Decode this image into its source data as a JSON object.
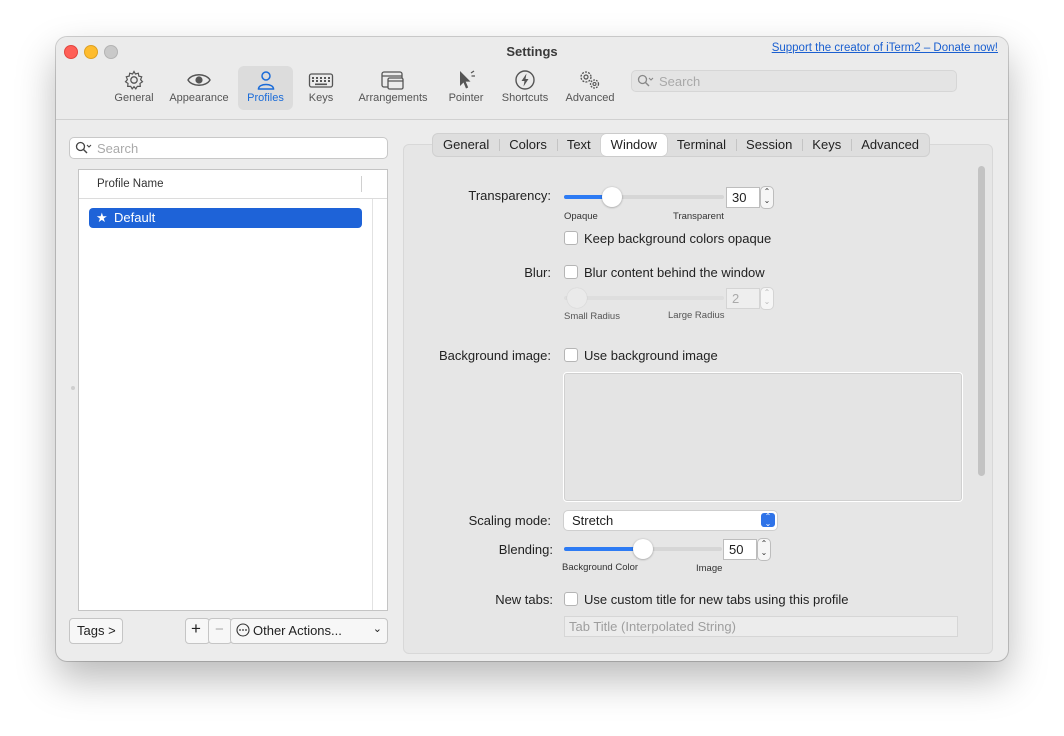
{
  "window": {
    "title": "Settings",
    "donate_link": "Support the creator of iTerm2 – Donate now!"
  },
  "toolbar": {
    "items": [
      {
        "label": "General",
        "icon": "gear-icon"
      },
      {
        "label": "Appearance",
        "icon": "eye-icon"
      },
      {
        "label": "Profiles",
        "icon": "person-icon",
        "active": true
      },
      {
        "label": "Keys",
        "icon": "keyboard-icon"
      },
      {
        "label": "Arrangements",
        "icon": "windows-icon"
      },
      {
        "label": "Pointer",
        "icon": "pointer-icon"
      },
      {
        "label": "Shortcuts",
        "icon": "bolt-icon"
      },
      {
        "label": "Advanced",
        "icon": "gears-icon"
      }
    ],
    "search_placeholder": "Search"
  },
  "sidebar": {
    "search_placeholder": "Search",
    "column_header": "Profile Name",
    "profiles": [
      {
        "name": "Default",
        "default": true,
        "selected": true
      }
    ],
    "tags_button": "Tags >",
    "add_button": "+",
    "remove_button": "−",
    "other_actions": "Other Actions..."
  },
  "tabs": [
    "General",
    "Colors",
    "Text",
    "Window",
    "Terminal",
    "Session",
    "Keys",
    "Advanced"
  ],
  "active_tab": "Window",
  "window_settings": {
    "transparency": {
      "label": "Transparency:",
      "value": "30",
      "fraction": 0.3,
      "min_label": "Opaque",
      "max_label": "Transparent",
      "keep_opaque_label": "Keep background colors opaque",
      "keep_opaque_checked": false
    },
    "blur": {
      "label": "Blur:",
      "checkbox_label": "Blur content behind the window",
      "checked": false,
      "radius": "2",
      "min_label": "Small Radius",
      "max_label": "Large Radius"
    },
    "background_image": {
      "label": "Background image:",
      "checkbox_label": "Use background image",
      "checked": false
    },
    "scaling_mode": {
      "label": "Scaling mode:",
      "value": "Stretch"
    },
    "blending": {
      "label": "Blending:",
      "value": "50",
      "fraction": 0.5,
      "min_label": "Background Color",
      "max_label": "Image"
    },
    "new_tabs": {
      "label": "New tabs:",
      "checkbox_label": "Use custom title for new tabs using this profile",
      "checked": false,
      "title_placeholder": "Tab Title (Interpolated String)"
    }
  },
  "colors": {
    "accent": "#1e63d8",
    "slider_fill": "#2d7bf4",
    "close": "#ff5f57",
    "minimize": "#febc2e"
  }
}
